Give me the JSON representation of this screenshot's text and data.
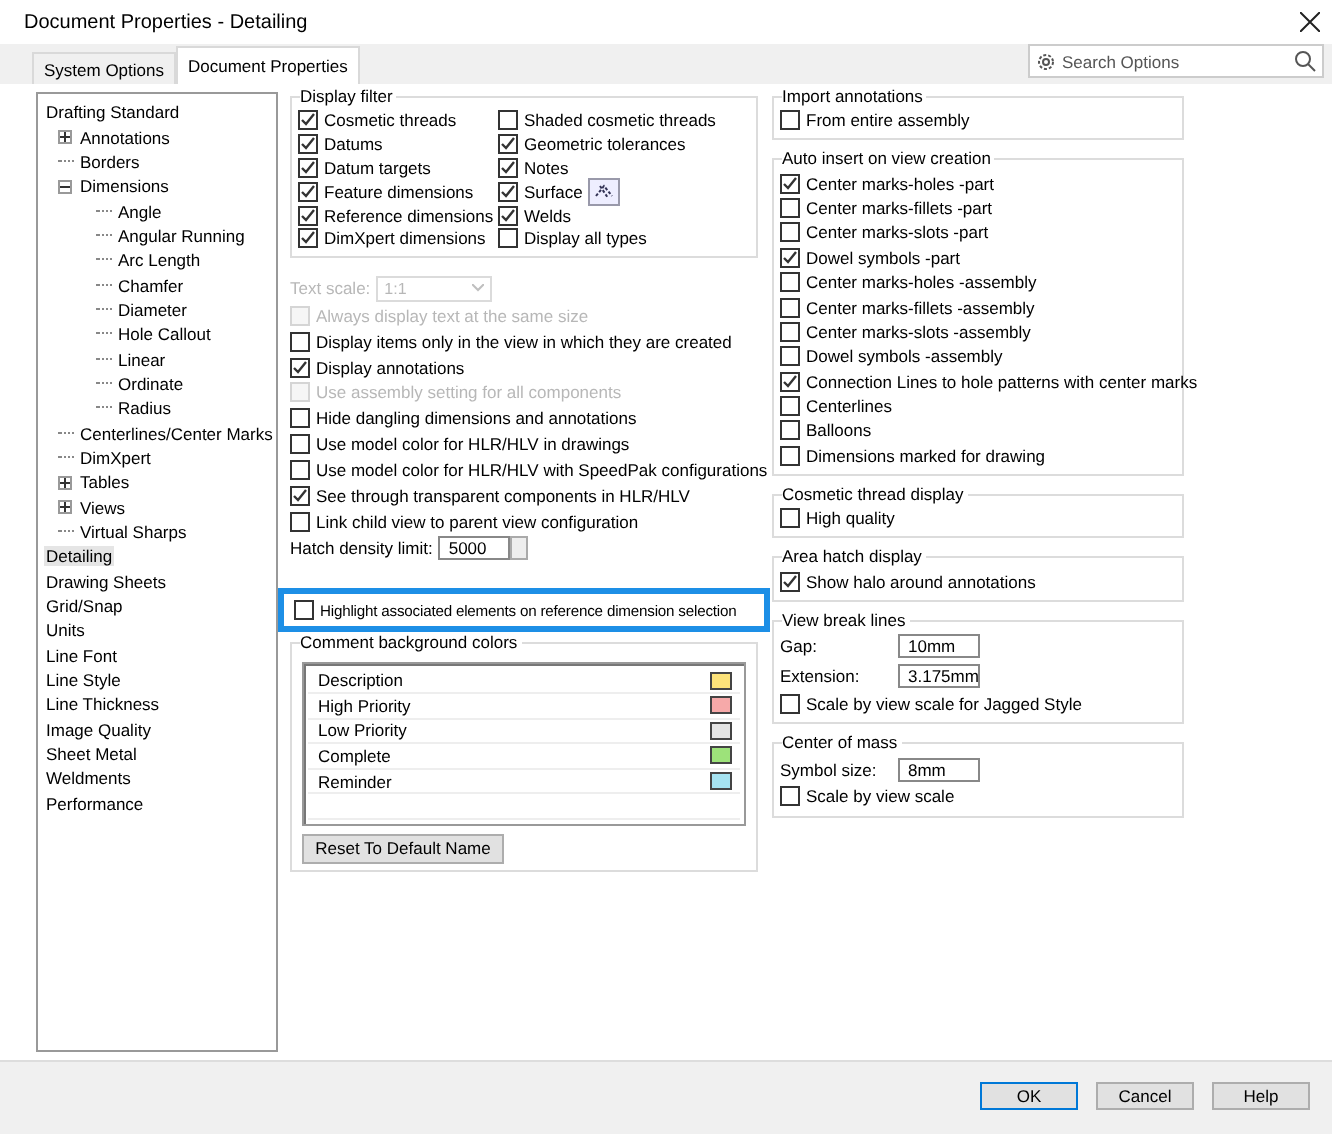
{
  "window": {
    "title": "Document Properties - Detailing"
  },
  "tabs": [
    {
      "label": "System Options",
      "selected": false
    },
    {
      "label": "Document Properties",
      "selected": true
    }
  ],
  "search": {
    "placeholder": "Search Options"
  },
  "tree": [
    {
      "label": "Drafting Standard",
      "selected": false,
      "children": [
        {
          "label": "Annotations",
          "selected": false,
          "expanded": false
        },
        {
          "label": "Borders",
          "selected": false
        },
        {
          "label": "Dimensions",
          "selected": false,
          "expanded": true,
          "children": [
            {
              "label": "Angle",
              "selected": false
            },
            {
              "label": "Angular Running",
              "selected": false
            },
            {
              "label": "Arc Length",
              "selected": false
            },
            {
              "label": "Chamfer",
              "selected": false
            },
            {
              "label": "Diameter",
              "selected": false
            },
            {
              "label": "Hole Callout",
              "selected": false
            },
            {
              "label": "Linear",
              "selected": false
            },
            {
              "label": "Ordinate",
              "selected": false
            },
            {
              "label": "Radius",
              "selected": false
            }
          ]
        },
        {
          "label": "Centerlines/Center Marks",
          "selected": false
        },
        {
          "label": "DimXpert",
          "selected": false
        },
        {
          "label": "Tables",
          "selected": false,
          "expanded": false
        },
        {
          "label": "Views",
          "selected": false,
          "expanded": false
        },
        {
          "label": "Virtual Sharps",
          "selected": false
        }
      ]
    },
    {
      "label": "Detailing",
      "selected": true
    },
    {
      "label": "Drawing Sheets",
      "selected": false
    },
    {
      "label": "Grid/Snap",
      "selected": false
    },
    {
      "label": "Units",
      "selected": false
    },
    {
      "label": "Line Font",
      "selected": false
    },
    {
      "label": "Line Style",
      "selected": false
    },
    {
      "label": "Line Thickness",
      "selected": false
    },
    {
      "label": "Image Quality",
      "selected": false
    },
    {
      "label": "Sheet Metal",
      "selected": false
    },
    {
      "label": "Weldments",
      "selected": false
    },
    {
      "label": "Performance",
      "selected": false
    }
  ],
  "display_filter": {
    "title": "Display filter",
    "items": [
      {
        "label": "Cosmetic threads",
        "checked": true
      },
      {
        "label": "Shaded cosmetic threads",
        "checked": false
      },
      {
        "label": "Datums",
        "checked": true
      },
      {
        "label": "Geometric tolerances",
        "checked": true
      },
      {
        "label": "Datum targets",
        "checked": true
      },
      {
        "label": "Notes",
        "checked": true
      },
      {
        "label": "Feature dimensions",
        "checked": true
      },
      {
        "label": "Surface",
        "checked": true,
        "pointer": true
      },
      {
        "label": "Reference dimensions",
        "checked": true
      },
      {
        "label": "Welds",
        "checked": true
      },
      {
        "label": "DimXpert dimensions",
        "checked": true
      },
      {
        "label": "Display all types",
        "checked": false
      }
    ]
  },
  "general": [
    {
      "kind": "select",
      "label": "Text scale:",
      "value": "1:1",
      "disabled": true
    },
    {
      "kind": "checkbox",
      "label": "Always display text at the same size",
      "checked": false,
      "disabled": true
    },
    {
      "kind": "checkbox",
      "label": "Display items only in the view in which they are created",
      "checked": false,
      "disabled": false
    },
    {
      "kind": "checkbox",
      "label": "Display annotations",
      "checked": true,
      "disabled": false
    },
    {
      "kind": "checkbox",
      "label": "Use assembly setting for all components",
      "checked": false,
      "disabled": true
    },
    {
      "kind": "checkbox",
      "label": "Hide dangling dimensions and annotations",
      "checked": false,
      "disabled": false
    },
    {
      "kind": "checkbox",
      "label": "Use model color for HLR/HLV in drawings",
      "checked": false,
      "disabled": false
    },
    {
      "kind": "checkbox",
      "label": "Use model color for HLR/HLV with SpeedPak configurations",
      "checked": false,
      "disabled": false
    },
    {
      "kind": "checkbox",
      "label": "See through transparent components in HLR/HLV",
      "checked": true,
      "disabled": false
    },
    {
      "kind": "checkbox",
      "label": "Link child view to parent view configuration",
      "checked": false,
      "disabled": false
    },
    {
      "kind": "spin",
      "label": "Hatch density limit:",
      "value": "5000"
    }
  ],
  "highlight": {
    "label": "Highlight associated elements on reference dimension selection",
    "checked": false,
    "outlined": true
  },
  "comment_colors": {
    "title": "Comment background colors",
    "rows": [
      {
        "label": "Description",
        "color": "#fde37a"
      },
      {
        "label": "High Priority",
        "color": "#f6a9a9"
      },
      {
        "label": "Low Priority",
        "color": "#e4e4e4"
      },
      {
        "label": "Complete",
        "color": "#9de27a"
      },
      {
        "label": "Reminder",
        "color": "#a6e3f1"
      }
    ],
    "button": "Reset To Default Name"
  },
  "right_groups": [
    {
      "title": "Import annotations",
      "rows": [
        {
          "kind": "checkbox",
          "label": "From entire assembly",
          "checked": false
        }
      ]
    },
    {
      "title": "Auto insert on view creation",
      "rows": [
        {
          "kind": "checkbox",
          "label": "Center marks-holes -part",
          "checked": true
        },
        {
          "kind": "checkbox",
          "label": "Center marks-fillets -part",
          "checked": false
        },
        {
          "kind": "checkbox",
          "label": "Center marks-slots  -part",
          "checked": false
        },
        {
          "kind": "checkbox",
          "label": "Dowel symbols -part",
          "checked": true
        },
        {
          "kind": "checkbox",
          "label": "Center marks-holes -assembly",
          "checked": false
        },
        {
          "kind": "checkbox",
          "label": "Center marks-fillets -assembly",
          "checked": false
        },
        {
          "kind": "checkbox",
          "label": "Center marks-slots  -assembly",
          "checked": false
        },
        {
          "kind": "checkbox",
          "label": "Dowel symbols -assembly",
          "checked": false
        },
        {
          "kind": "checkbox",
          "label": "Connection Lines to hole patterns with center marks",
          "checked": true
        },
        {
          "kind": "checkbox",
          "label": "Centerlines",
          "checked": false
        },
        {
          "kind": "checkbox",
          "label": "Balloons",
          "checked": false
        },
        {
          "kind": "checkbox",
          "label": "Dimensions marked for drawing",
          "checked": false
        }
      ]
    },
    {
      "title": "Cosmetic thread display",
      "rows": [
        {
          "kind": "checkbox",
          "label": "High quality",
          "checked": false
        }
      ]
    },
    {
      "title": "Area hatch display",
      "rows": [
        {
          "kind": "checkbox",
          "label": "Show halo around annotations",
          "checked": true
        }
      ]
    },
    {
      "title": "View break lines",
      "rows": [
        {
          "kind": "field",
          "label": "Gap:",
          "value": "10mm"
        },
        {
          "kind": "field",
          "label": "Extension:",
          "value": "3.175mm"
        },
        {
          "kind": "checkbox",
          "label": "Scale by view scale for Jagged Style",
          "checked": false
        }
      ]
    },
    {
      "title": "Center of mass",
      "rows": [
        {
          "kind": "field",
          "label": "Symbol size:",
          "value": "8mm"
        },
        {
          "kind": "checkbox",
          "label": "Scale by view scale",
          "checked": false
        }
      ]
    }
  ],
  "buttons": [
    {
      "label": "OK",
      "default": true
    },
    {
      "label": "Cancel",
      "default": false
    },
    {
      "label": "Help",
      "default": false
    }
  ]
}
